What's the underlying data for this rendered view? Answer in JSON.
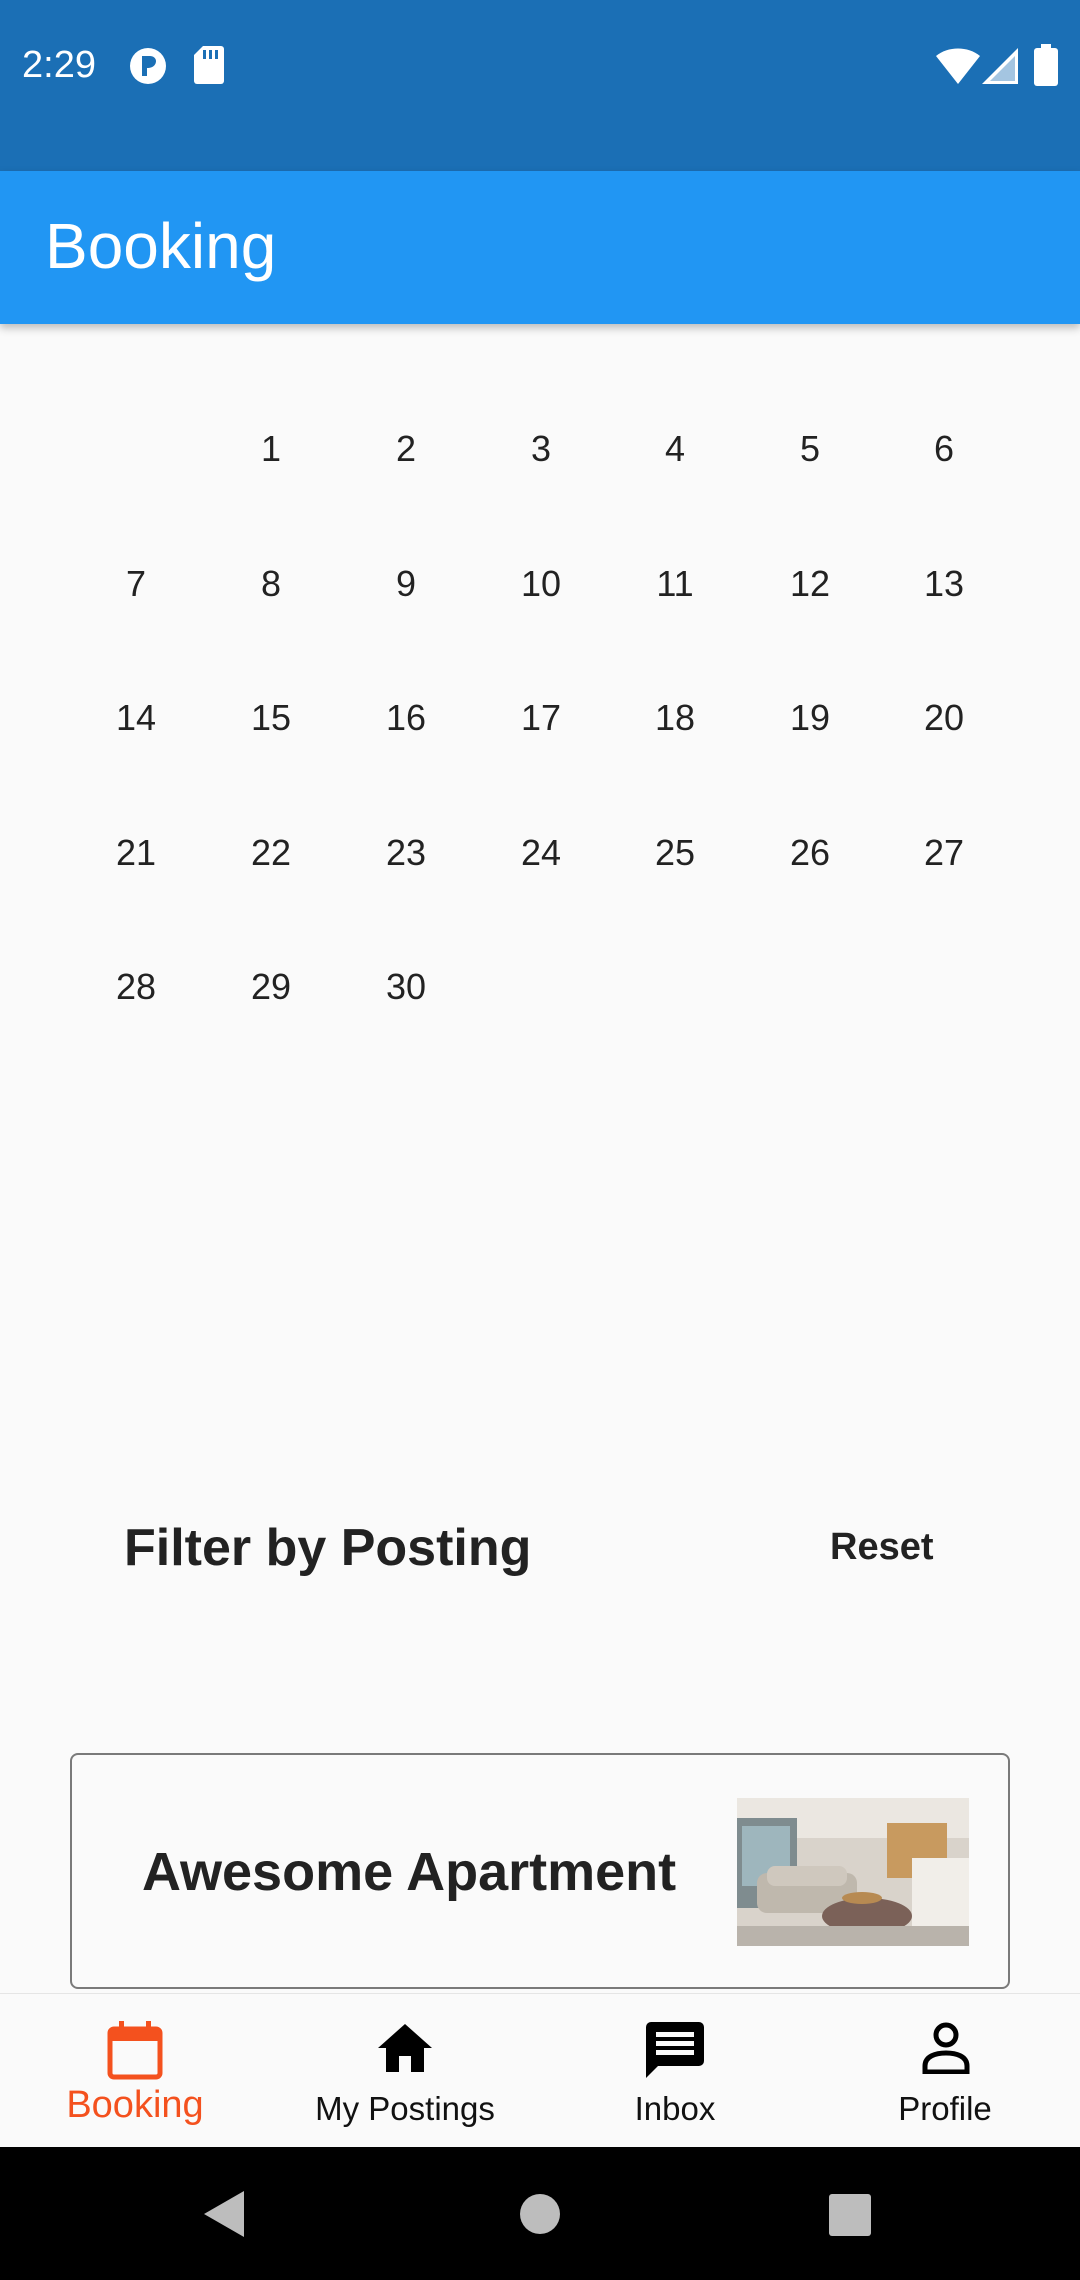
{
  "status": {
    "time": "2:29"
  },
  "app_bar": {
    "title": "Booking"
  },
  "calendar": {
    "weeks": [
      [
        "",
        "1",
        "2",
        "3",
        "4",
        "5",
        "6"
      ],
      [
        "7",
        "8",
        "9",
        "10",
        "11",
        "12",
        "13"
      ],
      [
        "14",
        "15",
        "16",
        "17",
        "18",
        "19",
        "20"
      ],
      [
        "21",
        "22",
        "23",
        "24",
        "25",
        "26",
        "27"
      ],
      [
        "28",
        "29",
        "30",
        "",
        "",
        "",
        ""
      ]
    ]
  },
  "filter": {
    "title": "Filter by Posting",
    "reset_label": "Reset"
  },
  "posting": {
    "name": "Awesome Apartment"
  },
  "bottom_nav": {
    "items": [
      {
        "label": "Booking",
        "icon": "calendar-icon",
        "active": true
      },
      {
        "label": "My Postings",
        "icon": "home-icon",
        "active": false
      },
      {
        "label": "Inbox",
        "icon": "message-icon",
        "active": false
      },
      {
        "label": "Profile",
        "icon": "person-icon",
        "active": false
      }
    ]
  },
  "colors": {
    "status_bar": "#1b6fb5",
    "app_bar": "#2196f3",
    "active": "#f4511e"
  }
}
